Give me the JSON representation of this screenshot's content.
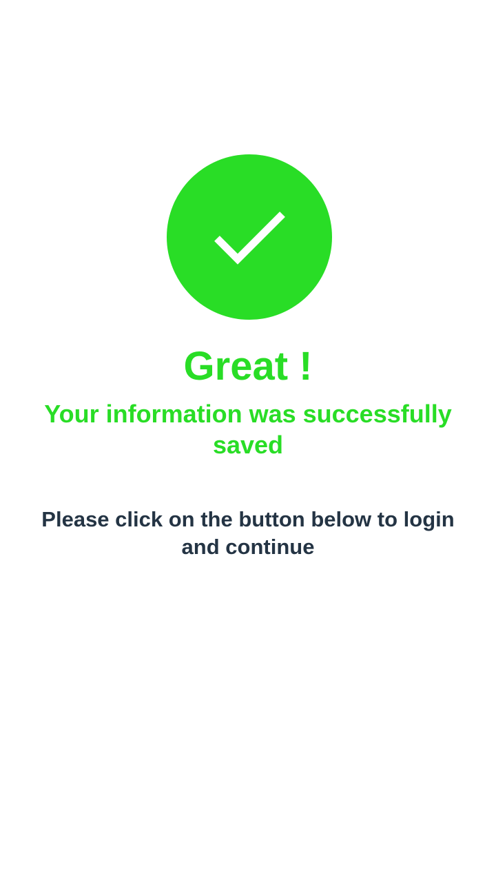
{
  "colors": {
    "accent": "#29DD26",
    "text_dark": "#243444",
    "background": "#ffffff"
  },
  "status_icon": "check-icon",
  "title": "Great !",
  "subtitle": "Your information was successfully saved",
  "instruction": "Please click on the button below to login and continue"
}
